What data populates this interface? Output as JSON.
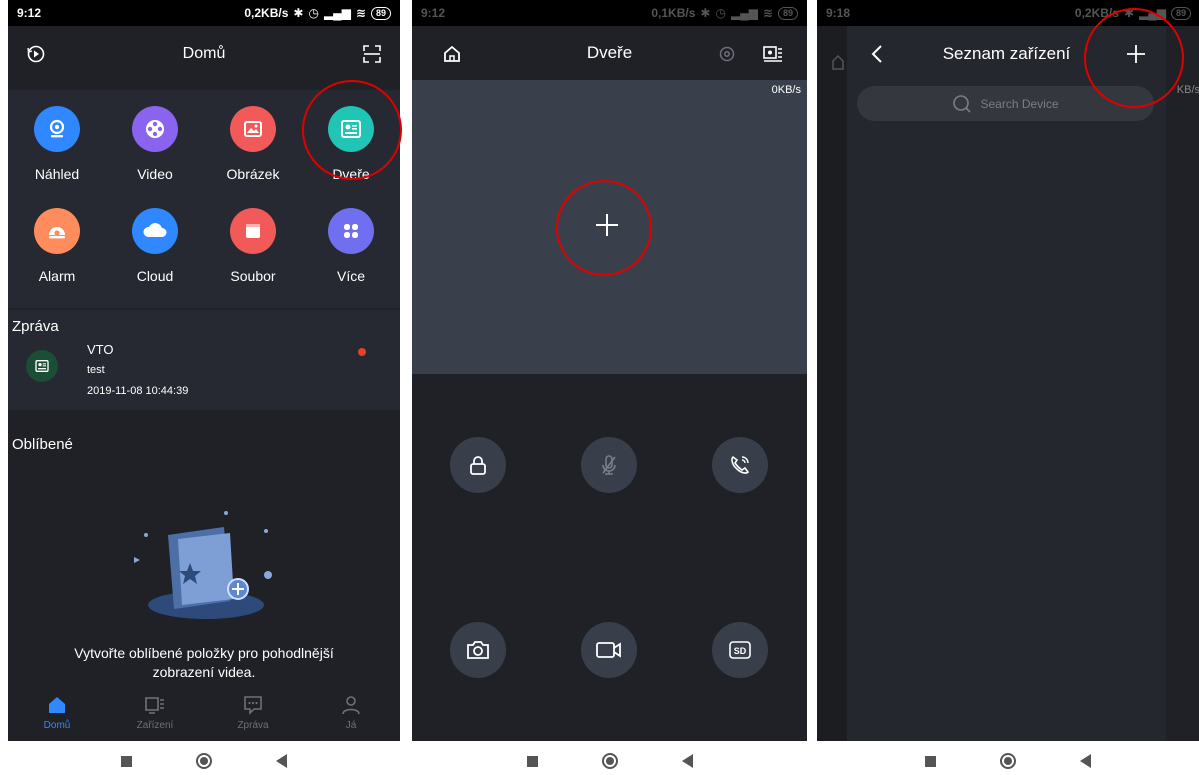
{
  "panel1": {
    "status": {
      "time": "9:12",
      "speed": "0,2KB/s",
      "battery": "89"
    },
    "header": {
      "title": "Domů"
    },
    "tiles": [
      {
        "label": "Náhled",
        "color": "#2f88ff",
        "icon": "camera-lens-icon"
      },
      {
        "label": "Video",
        "color": "#8a63ef",
        "icon": "film-reel-icon"
      },
      {
        "label": "Obrázek",
        "color": "#f25a5a",
        "icon": "picture-icon"
      },
      {
        "label": "Dveře",
        "color": "#20c5b5",
        "icon": "door-station-icon"
      },
      {
        "label": "Alarm",
        "color": "#ff8c5c",
        "icon": "alarm-icon"
      },
      {
        "label": "Cloud",
        "color": "#2f88ff",
        "icon": "cloud-icon"
      },
      {
        "label": "Soubor",
        "color": "#f25a5a",
        "icon": "folder-icon"
      },
      {
        "label": "Více",
        "color": "#6f6ff0",
        "icon": "more-apps-icon"
      }
    ],
    "message": {
      "section": "Zpráva",
      "name": "VTO",
      "body": "test",
      "time": "2019-11-08 10:44:39"
    },
    "favorites": {
      "section": "Oblíbené",
      "empty_line1": "Vytvořte oblíbené položky pro pohodlnější",
      "empty_line2": "zobrazení videa."
    },
    "tabs": [
      {
        "label": "Domů",
        "active": true
      },
      {
        "label": "Zařízení",
        "active": false
      },
      {
        "label": "Zpráva",
        "active": false
      },
      {
        "label": "Já",
        "active": false
      }
    ]
  },
  "panel2": {
    "status": {
      "time": "9:12",
      "speed": "0,1KB/s",
      "battery": "89"
    },
    "header": {
      "title": "Dveře"
    },
    "speed_overlay": "0KB/s"
  },
  "panel3": {
    "status": {
      "time": "9:18",
      "speed": "0,2KB/s",
      "battery": "89"
    },
    "header": {
      "title": "Seznam zařízení"
    },
    "search": {
      "placeholder": "Search Device"
    },
    "speed_overlay": "KB/s"
  }
}
